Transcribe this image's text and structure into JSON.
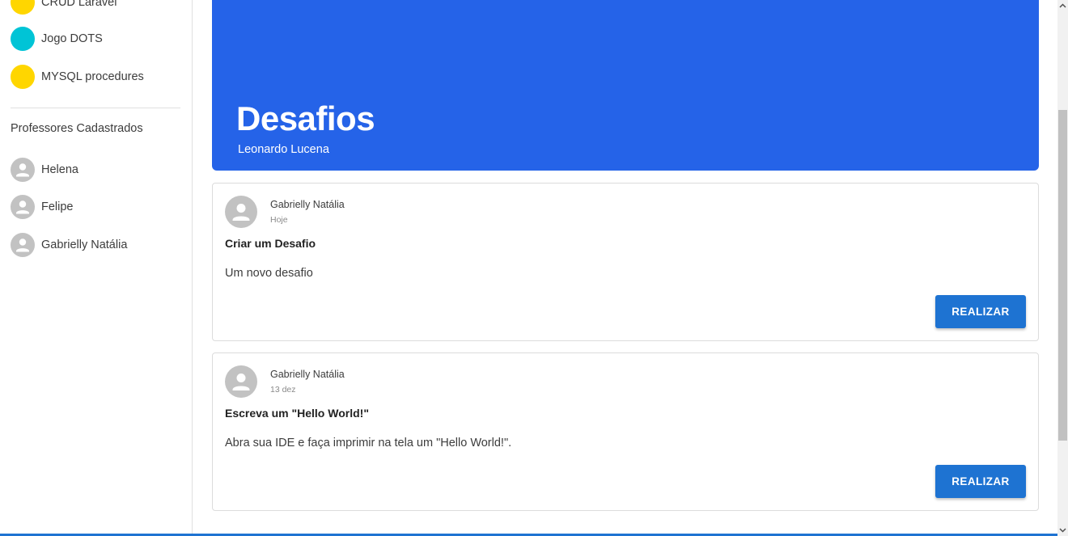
{
  "sidebar": {
    "classes": [
      {
        "label": "CRUD Laravel",
        "color": "#ffd600"
      },
      {
        "label": "Jogo DOTS",
        "color": "#00c4d6"
      },
      {
        "label": "MYSQL procedures",
        "color": "#ffd600"
      }
    ],
    "professors_title": "Professores Cadastrados",
    "professors": [
      {
        "name": "Helena"
      },
      {
        "name": "Felipe"
      },
      {
        "name": "Gabrielly Natália"
      }
    ]
  },
  "banner": {
    "title": "Desafios",
    "subtitle": "Leonardo Lucena",
    "color": "#2563e8"
  },
  "challenges": [
    {
      "author": "Gabrielly Natália",
      "date": "Hoje",
      "title": "Criar um Desafio",
      "description": "Um novo desafio",
      "button_label": "REALIZAR"
    },
    {
      "author": "Gabrielly Natália",
      "date": "13 dez",
      "title": "Escreva um \"Hello World!\"",
      "description": "Abra sua IDE e faça imprimir na tela um \"Hello World!\".",
      "button_label": "REALIZAR"
    }
  ],
  "colors": {
    "accent_button": "#1e73d2",
    "avatar_gray": "#c2c2c2"
  }
}
